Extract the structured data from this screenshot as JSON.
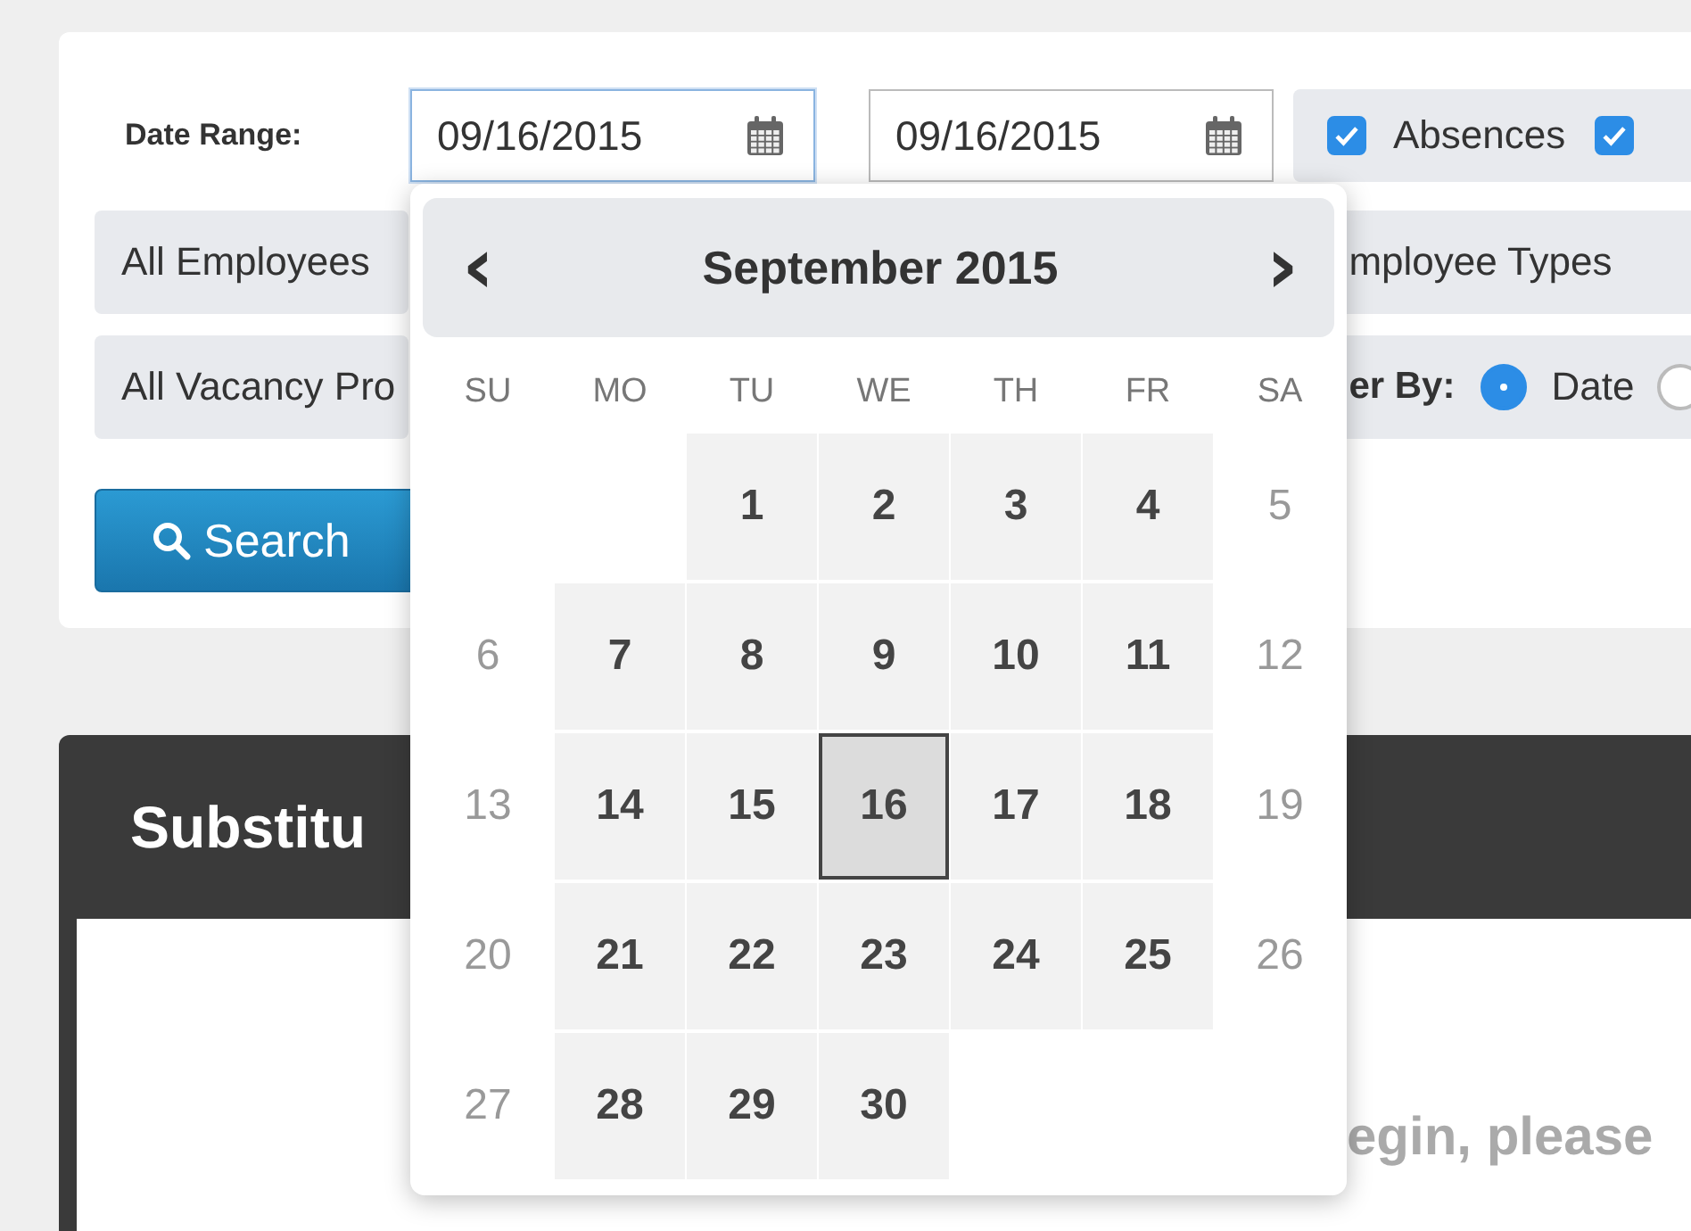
{
  "filters": {
    "date_range_label": "Date Range:",
    "start_date": {
      "value": "09/16/2015",
      "focused": true
    },
    "end_date": {
      "value": "09/16/2015",
      "focused": false
    },
    "checkboxes": [
      {
        "label": "Absences",
        "checked": true
      },
      {
        "checked": true
      }
    ],
    "employees_select": "All Employees",
    "employee_types_select": "mployee Types",
    "vacancy_select": "All Vacancy Pro",
    "order_by_label": "er By:",
    "radios": [
      {
        "label": "Date",
        "selected": true
      },
      {
        "selected": false
      }
    ],
    "search_button": "Search"
  },
  "datepicker": {
    "title": "September 2015",
    "prev": "‹",
    "next": "›",
    "weekdays": [
      "SU",
      "MO",
      "TU",
      "WE",
      "TH",
      "FR",
      "SA"
    ],
    "weeks": [
      {
        "kind": "first",
        "days": [
          {
            "day": "1",
            "kind": "weekday",
            "selected": false
          },
          {
            "day": "2",
            "kind": "weekday",
            "selected": false
          },
          {
            "day": "3",
            "kind": "weekday",
            "selected": false
          },
          {
            "day": "4",
            "kind": "weekday",
            "selected": false
          },
          {
            "day": "5",
            "kind": "weekend",
            "selected": false
          }
        ]
      },
      {
        "kind": "full",
        "days": [
          {
            "day": "6",
            "kind": "weekend",
            "selected": false
          },
          {
            "day": "7",
            "kind": "weekday",
            "selected": false
          },
          {
            "day": "8",
            "kind": "weekday",
            "selected": false
          },
          {
            "day": "9",
            "kind": "weekday",
            "selected": false
          },
          {
            "day": "10",
            "kind": "weekday",
            "selected": false
          },
          {
            "day": "11",
            "kind": "weekday",
            "selected": false
          },
          {
            "day": "12",
            "kind": "weekend",
            "selected": false
          }
        ]
      },
      {
        "kind": "full",
        "days": [
          {
            "day": "13",
            "kind": "weekend",
            "selected": false
          },
          {
            "day": "14",
            "kind": "weekday",
            "selected": false
          },
          {
            "day": "15",
            "kind": "weekday",
            "selected": false
          },
          {
            "day": "16",
            "kind": "weekday",
            "selected": true
          },
          {
            "day": "17",
            "kind": "weekday",
            "selected": false
          },
          {
            "day": "18",
            "kind": "weekday",
            "selected": false
          },
          {
            "day": "19",
            "kind": "weekend",
            "selected": false
          }
        ]
      },
      {
        "kind": "full",
        "days": [
          {
            "day": "20",
            "kind": "weekend",
            "selected": false
          },
          {
            "day": "21",
            "kind": "weekday",
            "selected": false
          },
          {
            "day": "22",
            "kind": "weekday",
            "selected": false
          },
          {
            "day": "23",
            "kind": "weekday",
            "selected": false
          },
          {
            "day": "24",
            "kind": "weekday",
            "selected": false
          },
          {
            "day": "25",
            "kind": "weekday",
            "selected": false
          },
          {
            "day": "26",
            "kind": "weekend",
            "selected": false
          }
        ]
      },
      {
        "kind": "last",
        "days": [
          {
            "day": "27",
            "kind": "weekend",
            "selected": false
          },
          {
            "day": "28",
            "kind": "weekday",
            "selected": false
          },
          {
            "day": "29",
            "kind": "weekday",
            "selected": false
          },
          {
            "day": "30",
            "kind": "weekday",
            "selected": false
          }
        ]
      }
    ]
  },
  "results_panel": {
    "title": "Substitu",
    "message": "egin, please"
  }
}
